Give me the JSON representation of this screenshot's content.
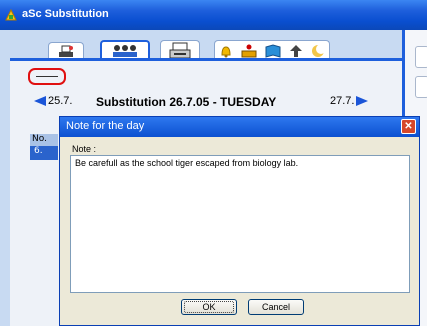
{
  "window": {
    "title": "aSc Substitution"
  },
  "toolbar": {
    "tools": [
      "printer-broom-icon",
      "people-icon",
      "printer-icon",
      "bell-icon",
      "person-lectern-icon",
      "book-icon",
      "upload-arrow-icon",
      "moon-icon"
    ]
  },
  "navigation": {
    "prev_date": "25.7.",
    "heading": "Substitution 26.7.05 - TUESDAY",
    "next_date": "27.7."
  },
  "grid": {
    "column_header": "No.",
    "rows": [
      "6."
    ]
  },
  "dialog": {
    "title": "Note for the day",
    "note_label": "Note :",
    "note_text": "Be carefull as the school tiger escaped from biology lab.",
    "ok_label": "OK",
    "cancel_label": "Cancel"
  },
  "colors": {
    "title_bar": "#0a4fd0",
    "highlight_circle": "#e01010",
    "accent": "#1e5fdc"
  }
}
